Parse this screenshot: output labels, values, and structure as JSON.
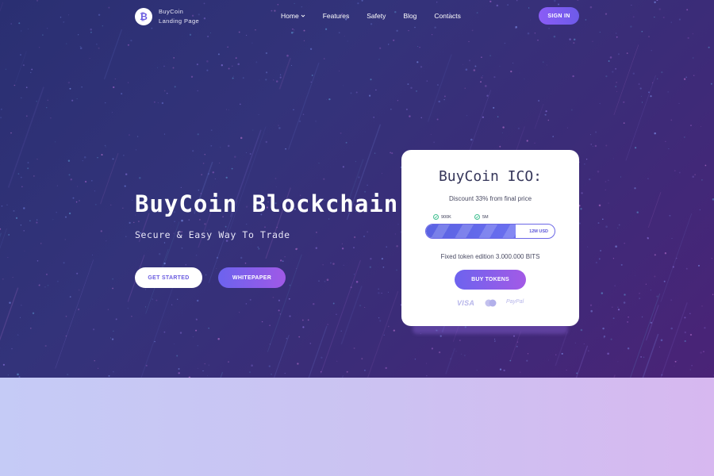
{
  "brand": {
    "name": "BuyCoin",
    "tagline": "Landing Page",
    "logo_glyph": "₿"
  },
  "nav": {
    "items": [
      {
        "label": "Home",
        "has_dropdown": true
      },
      {
        "label": "Features"
      },
      {
        "label": "Safety"
      },
      {
        "label": "Blog"
      },
      {
        "label": "Contacts"
      }
    ],
    "sign_in_label": "SIGN IN"
  },
  "hero": {
    "title": "BuyCoin Blockchain",
    "subtitle": "Secure & Easy Way To Trade",
    "primary_button": "GET STARTED",
    "secondary_button": "WHITEPAPER"
  },
  "ico_card": {
    "title": "BuyCoin ICO:",
    "discount_text": "Discount 33% from final price",
    "milestones": [
      "900K",
      "5M"
    ],
    "progress_label": "12M USD",
    "progress_fraction": 0.7,
    "fixed_edition_text": "Fixed token edition 3.000.000 BITS",
    "buy_button": "BUY TOKENS",
    "payments": {
      "visa": "VISA",
      "paypal": "PayPal"
    }
  },
  "colors": {
    "hero_start": "#2a2f72",
    "hero_end": "#4a2377",
    "accent_start": "#6c63ee",
    "accent_end": "#a059e6",
    "lower_start": "#c5cbf6",
    "lower_end": "#d7b8f0"
  }
}
